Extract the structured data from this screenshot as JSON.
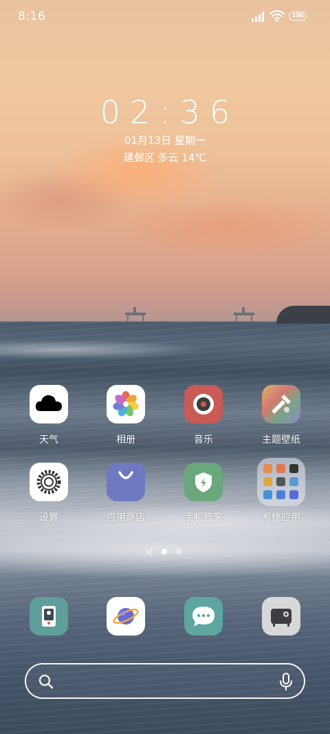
{
  "status_bar": {
    "time": "8:16",
    "battery": "100"
  },
  "lock_widget": {
    "clock": "02:36",
    "date": "01月13日 星期一",
    "weather": "建邺区 多云 14℃"
  },
  "apps_row1": [
    {
      "label": "天气",
      "icon": "weather-icon"
    },
    {
      "label": "相册",
      "icon": "gallery-icon"
    },
    {
      "label": "音乐",
      "icon": "music-icon"
    },
    {
      "label": "主题壁纸",
      "icon": "themes-icon"
    }
  ],
  "apps_row2": [
    {
      "label": "设置",
      "icon": "settings-icon"
    },
    {
      "label": "应用商店",
      "icon": "app-store-icon"
    },
    {
      "label": "手机管家",
      "icon": "security-icon"
    },
    {
      "label": "系统应用",
      "icon": "folder-icon"
    }
  ],
  "dock": [
    {
      "icon": "phone-icon"
    },
    {
      "icon": "browser-icon"
    },
    {
      "icon": "messages-icon"
    },
    {
      "icon": "camera-icon"
    }
  ],
  "page_indicator": {
    "pages": 2,
    "current": 1
  },
  "search_bar": {
    "placeholder": ""
  },
  "colors": {
    "music": "#c95a55",
    "app_store": "#6f79c2",
    "security": "#6aa77a",
    "phone_dock": "#5f9f9b",
    "messages": "#5fa6a2"
  }
}
